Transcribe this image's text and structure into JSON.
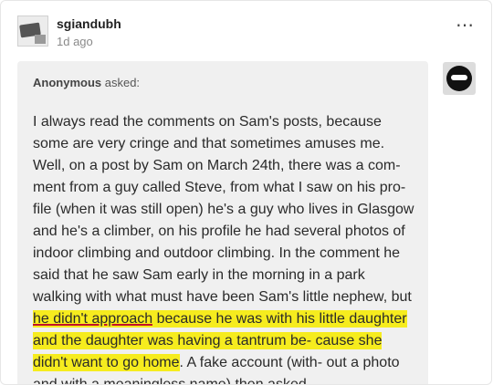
{
  "post": {
    "username": "sgiandubh",
    "timestamp": "1d ago",
    "more_icon": "⋯"
  },
  "ask": {
    "asker_name": "Anonymous",
    "asker_suffix": " asked:",
    "text_parts": {
      "p1": "I always read the comments on Sam's posts, because some are very cringe and that sometimes amuses me. Well, on a post by Sam on March 24th, there was a com- ment from a guy called Steve, from what I saw on his pro- file (when it was still open) he's a guy who lives in Glasgow and he's a climber, on his profile he had several photos of indoor climbing and outdoor climbing.  In the comment he said that he saw Sam early in the morning in a park walking with what must have been Sam's little nephew, but ",
      "p2": "he didn't approach",
      "p3": " because he was with his little daughter and the daughter was having a tantrum be- cause she didn't want to go home",
      "p4": ".  A fake account (with- out a photo and with a meaningless name) then asked"
    }
  }
}
